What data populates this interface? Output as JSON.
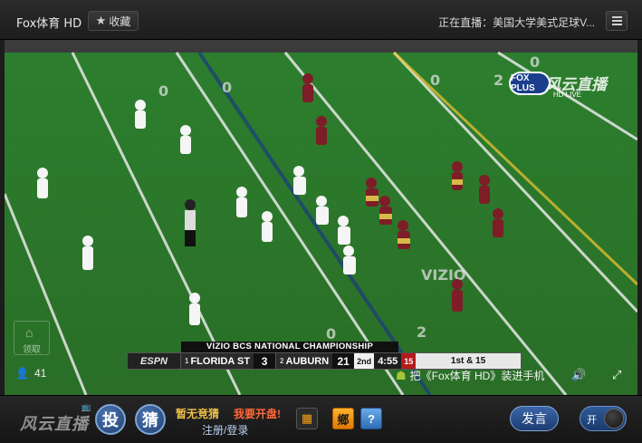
{
  "titlebar": {
    "channel": "Fox体育 HD",
    "favorite_label": "收藏",
    "now_playing": "正在直播：美国大学美式足球V..."
  },
  "video": {
    "watermark_brand": "风云直播",
    "channel_logo": "FOX PLUS",
    "channel_logo_sub": "HD LIVE",
    "side_badge": "领取",
    "scorebug": {
      "title": "VIZIO BCS NATIONAL CHAMPIONSHIP",
      "network": "ESPN",
      "team1_rank": "1",
      "team1": "FLORIDA ST",
      "team1_score": "3",
      "team2_rank": "2",
      "team2": "AUBURN",
      "team2_score": "21",
      "quarter": "2nd",
      "clock": "4:55",
      "play_clock": "15",
      "down_distance": "1st & 15"
    },
    "viewers": "41",
    "app_promo": "把《Fox体育 HD》装进手机"
  },
  "bottombar": {
    "brand": "风云直播",
    "bet_button": "投",
    "guess_button": "猜",
    "guess_status": "暂无竞猜",
    "open_bet": "我要开盘!",
    "login_register": "注册/登录",
    "grid_icon": "grid-icon",
    "bang_button": "鄉",
    "help_icon": "help-icon",
    "send_button": "发言",
    "toggle_label": "开"
  },
  "colors": {
    "accent_blue": "#2d5fa6",
    "gold": "#f0c24a",
    "orange": "#ff6a3a"
  }
}
